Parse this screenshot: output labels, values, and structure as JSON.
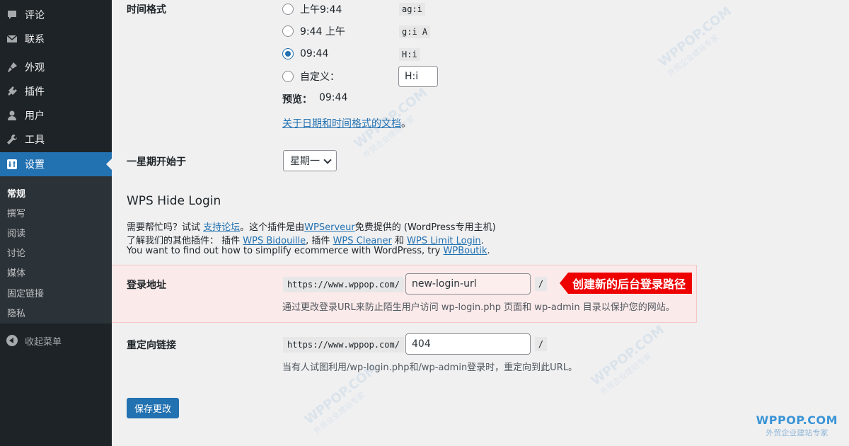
{
  "sidebar": {
    "items": [
      {
        "label": "评论",
        "icon": "comment-icon"
      },
      {
        "label": "联系",
        "icon": "mail-icon"
      },
      {
        "label": "外观",
        "icon": "brush-icon"
      },
      {
        "label": "插件",
        "icon": "plugin-icon"
      },
      {
        "label": "用户",
        "icon": "user-icon"
      },
      {
        "label": "工具",
        "icon": "wrench-icon"
      },
      {
        "label": "设置",
        "icon": "settings-icon"
      }
    ],
    "submenu": [
      "常规",
      "撰写",
      "阅读",
      "讨论",
      "媒体",
      "固定链接",
      "隐私"
    ],
    "collapse_label": "收起菜单"
  },
  "time_format": {
    "label": "时间格式",
    "options": [
      {
        "text": "上午9:44",
        "code": "ag:i",
        "checked": false
      },
      {
        "text": "9:44 上午",
        "code": "g:i A",
        "checked": false
      },
      {
        "text": "09:44",
        "code": "H:i",
        "checked": true
      },
      {
        "text": "自定义：",
        "code": "",
        "checked": false
      }
    ],
    "custom_value": "H:i",
    "preview_label": "预览：",
    "preview_value": "09:44",
    "doc_link": "关于日期和时间格式的文档",
    "doc_suffix": "。"
  },
  "week_start": {
    "label": "一星期开始于",
    "selected": "星期一"
  },
  "wps": {
    "title": "WPS Hide Login",
    "line1": {
      "a": "需要帮忙吗？试试 ",
      "link1": "支持论坛",
      "b": "。这个插件是由",
      "link2": "WPServeur",
      "c": "免费提供的 (WordPress专用主机)"
    },
    "line2": {
      "a": "了解我们的其他插件： 插件 ",
      "link1": "WPS Bidouille",
      "b": ", 插件 ",
      "link2": "WPS Cleaner",
      "c": " 和 ",
      "link3": "WPS Limit Login",
      "d": "."
    },
    "line3": {
      "a": "You want to find out how to simplify ecommerce with WordPress, try ",
      "link1": "WPBoutik",
      "b": "."
    }
  },
  "login_url": {
    "label": "登录地址",
    "prefix": "https://www.wppop.com/",
    "value": "new-login-url",
    "suffix": "/",
    "desc": "通过更改登录URL来防止陌生用户访问 wp-login.php 页面和 wp-admin 目录以保护您的网站。",
    "callout": "创建新的后台登录路径"
  },
  "redirect_url": {
    "label": "重定向链接",
    "prefix": "https://www.wppop.com/",
    "value": "404",
    "suffix": "/",
    "desc": "当有人试图利用/wp-login.php和/wp-admin登录时，重定向到此URL。"
  },
  "save_label": "保存更改",
  "watermark": {
    "brand": "WPPOP.COM",
    "tagline": "外贸企业建站专家"
  },
  "colors": {
    "sidebar_bg": "#1d2327",
    "accent": "#2271b1",
    "callout": "#e00000",
    "highlight_bg": "#fbeaea"
  }
}
